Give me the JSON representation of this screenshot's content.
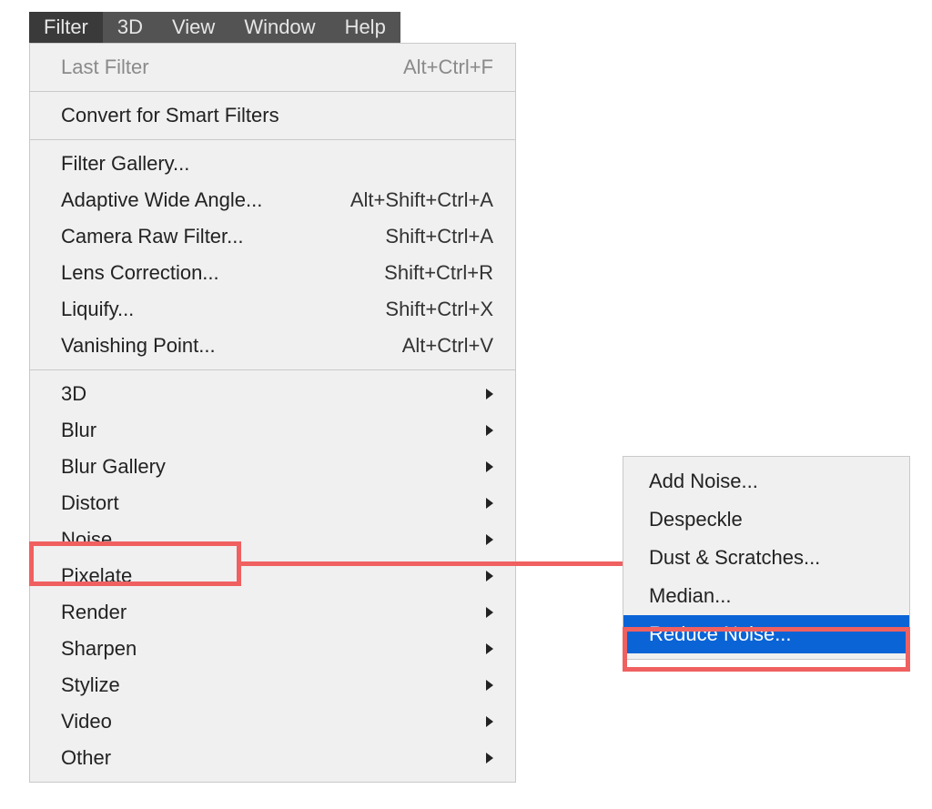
{
  "menubar": {
    "items": [
      {
        "label": "Filter",
        "active": true
      },
      {
        "label": "3D",
        "active": false
      },
      {
        "label": "View",
        "active": false
      },
      {
        "label": "Window",
        "active": false
      },
      {
        "label": "Help",
        "active": false
      }
    ]
  },
  "dropdown": {
    "section1": [
      {
        "label": "Last Filter",
        "shortcut": "Alt+Ctrl+F",
        "disabled": true
      }
    ],
    "section2": [
      {
        "label": "Convert for Smart Filters"
      }
    ],
    "section3": [
      {
        "label": "Filter Gallery..."
      },
      {
        "label": "Adaptive Wide Angle...",
        "shortcut": "Alt+Shift+Ctrl+A"
      },
      {
        "label": "Camera Raw Filter...",
        "shortcut": "Shift+Ctrl+A"
      },
      {
        "label": "Lens Correction...",
        "shortcut": "Shift+Ctrl+R"
      },
      {
        "label": "Liquify...",
        "shortcut": "Shift+Ctrl+X"
      },
      {
        "label": "Vanishing Point...",
        "shortcut": "Alt+Ctrl+V"
      }
    ],
    "section4": [
      {
        "label": "3D",
        "submenu": true
      },
      {
        "label": "Blur",
        "submenu": true
      },
      {
        "label": "Blur Gallery",
        "submenu": true
      },
      {
        "label": "Distort",
        "submenu": true
      },
      {
        "label": "Noise",
        "submenu": true,
        "highlighted": true
      },
      {
        "label": "Pixelate",
        "submenu": true
      },
      {
        "label": "Render",
        "submenu": true
      },
      {
        "label": "Sharpen",
        "submenu": true
      },
      {
        "label": "Stylize",
        "submenu": true
      },
      {
        "label": "Video",
        "submenu": true
      },
      {
        "label": "Other",
        "submenu": true
      }
    ]
  },
  "submenu": {
    "items": [
      {
        "label": "Add Noise..."
      },
      {
        "label": "Despeckle"
      },
      {
        "label": "Dust & Scratches..."
      },
      {
        "label": "Median..."
      },
      {
        "label": "Reduce Noise...",
        "selected": true,
        "highlighted": true
      }
    ]
  },
  "annotations": {
    "highlight_color": "#f06060",
    "selection_bg": "#0a64d6"
  }
}
